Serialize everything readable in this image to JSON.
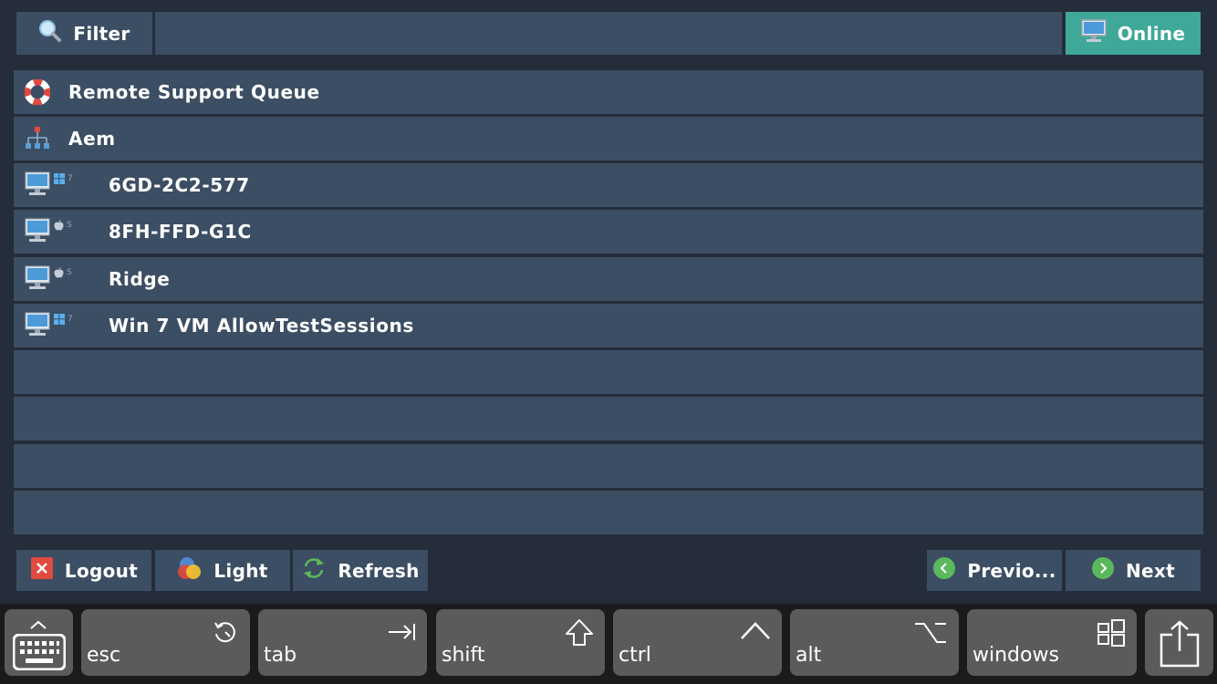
{
  "toolbar": {
    "filter_label": "Filter",
    "filter_value": "",
    "online_label": "Online"
  },
  "list": {
    "groups": [
      {
        "label": "Remote Support Queue",
        "icon": "lifebuoy-icon"
      },
      {
        "label": "Aem",
        "icon": "org-tree-icon"
      }
    ],
    "computers": [
      {
        "label": "6GD-2C2-577",
        "os": "windows",
        "os_version": "7"
      },
      {
        "label": "8FH-FFD-G1C",
        "os": "apple",
        "os_version": "S"
      },
      {
        "label": "Ridge",
        "os": "apple",
        "os_version": "S"
      },
      {
        "label": "Win 7 VM AllowTestSessions",
        "os": "windows",
        "os_version": "7"
      }
    ]
  },
  "footer": {
    "logout_label": "Logout",
    "light_label": "Light",
    "refresh_label": "Refresh",
    "prev_label": "Previo...",
    "next_label": "Next"
  },
  "keyboard": {
    "esc": "esc",
    "tab": "tab",
    "shift": "shift",
    "ctrl": "ctrl",
    "alt": "alt",
    "windows": "windows"
  },
  "colors": {
    "background": "#242d39",
    "panel": "#3c4e63",
    "online_accent": "#3fa898",
    "nav_green": "#5cb85c",
    "logout_red": "#e04a3f"
  }
}
